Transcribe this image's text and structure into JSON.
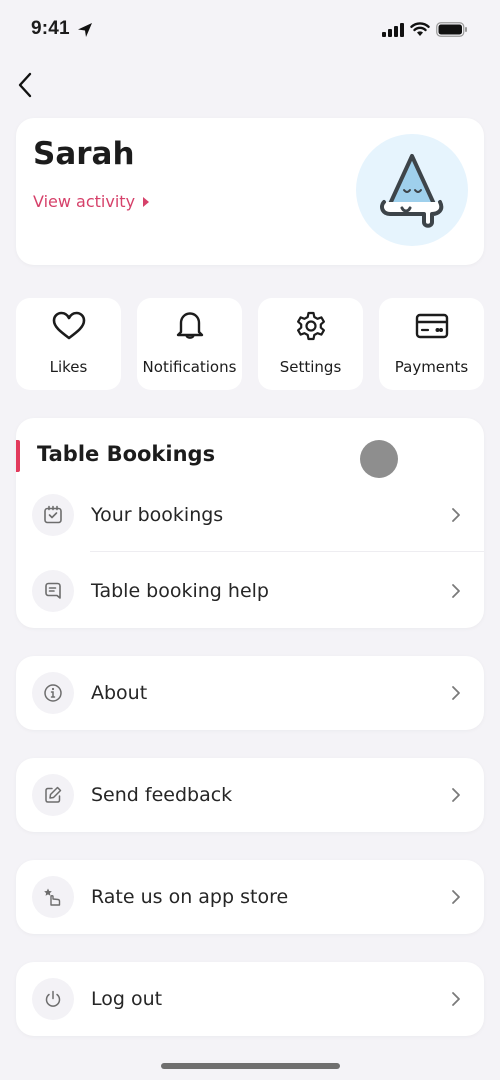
{
  "status_bar": {
    "time": "9:41",
    "icons": [
      "location-arrow-icon",
      "cellular-signal-icon",
      "wifi-icon",
      "battery-icon"
    ]
  },
  "nav": {
    "back_icon": "chevron-left-icon"
  },
  "profile": {
    "name": "Sarah",
    "view_activity_label": "View activity",
    "avatar_icon": "drip-mascot-avatar"
  },
  "quick_actions": [
    {
      "label": "Likes",
      "icon": "heart-icon"
    },
    {
      "label": "Notifications",
      "icon": "bell-icon"
    },
    {
      "label": "Settings",
      "icon": "gear-icon"
    },
    {
      "label": "Payments",
      "icon": "credit-card-icon"
    }
  ],
  "table_bookings": {
    "title": "Table Bookings",
    "accent_color": "#e23a5c",
    "items": [
      {
        "label": "Your bookings",
        "icon": "calendar-check-icon"
      },
      {
        "label": "Table booking help",
        "icon": "chat-help-icon"
      }
    ]
  },
  "menu_items": [
    {
      "label": "About",
      "icon": "info-icon"
    },
    {
      "label": "Send feedback",
      "icon": "edit-icon"
    },
    {
      "label": "Rate us on app store",
      "icon": "star-tap-icon"
    },
    {
      "label": "Log out",
      "icon": "power-icon"
    }
  ],
  "colors": {
    "accent": "#d6416a",
    "background": "#f4f3f7",
    "card": "#ffffff",
    "avatar_bg": "#e6f4fd"
  }
}
